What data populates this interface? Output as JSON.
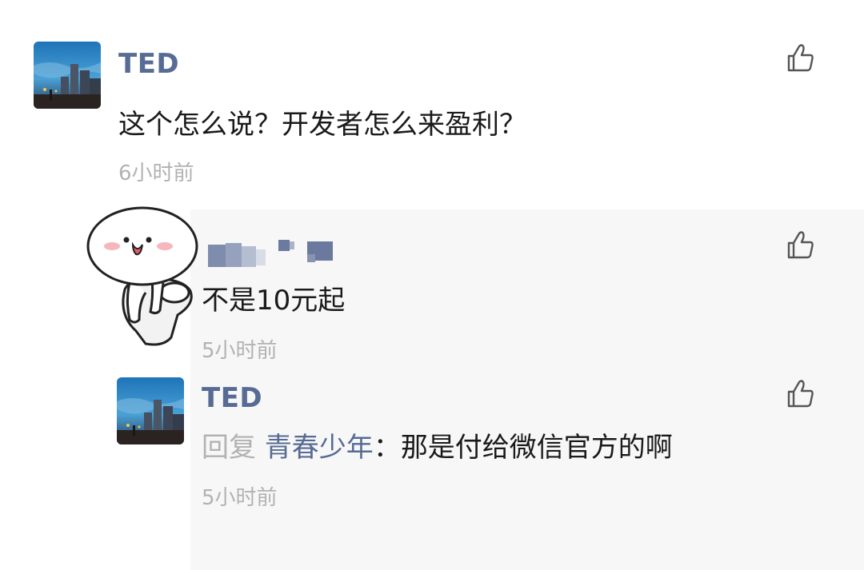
{
  "comments": [
    {
      "username": "TED",
      "content": "这个怎么说？开发者怎么来盈利？",
      "time": "6小时前",
      "avatar_icon": "city-night-avatar",
      "like_icon": "thumbs-up-icon"
    },
    {
      "username": "",
      "username_blurred": true,
      "content": "不是10元起",
      "time": "5小时前",
      "avatar_icon": "cartoon-sticker-avatar",
      "like_icon": "thumbs-up-icon"
    },
    {
      "username": "TED",
      "reply_word": "回复",
      "reply_target": "青春少年",
      "reply_separator": "：",
      "content": "那是付给微信官方的啊",
      "time": "5小时前",
      "avatar_icon": "city-night-avatar",
      "like_icon": "thumbs-up-icon"
    }
  ],
  "colors": {
    "username": "#576b95",
    "text": "#1a1a1a",
    "meta": "#b2b2b2",
    "reply_bg": "#f7f7f7"
  }
}
